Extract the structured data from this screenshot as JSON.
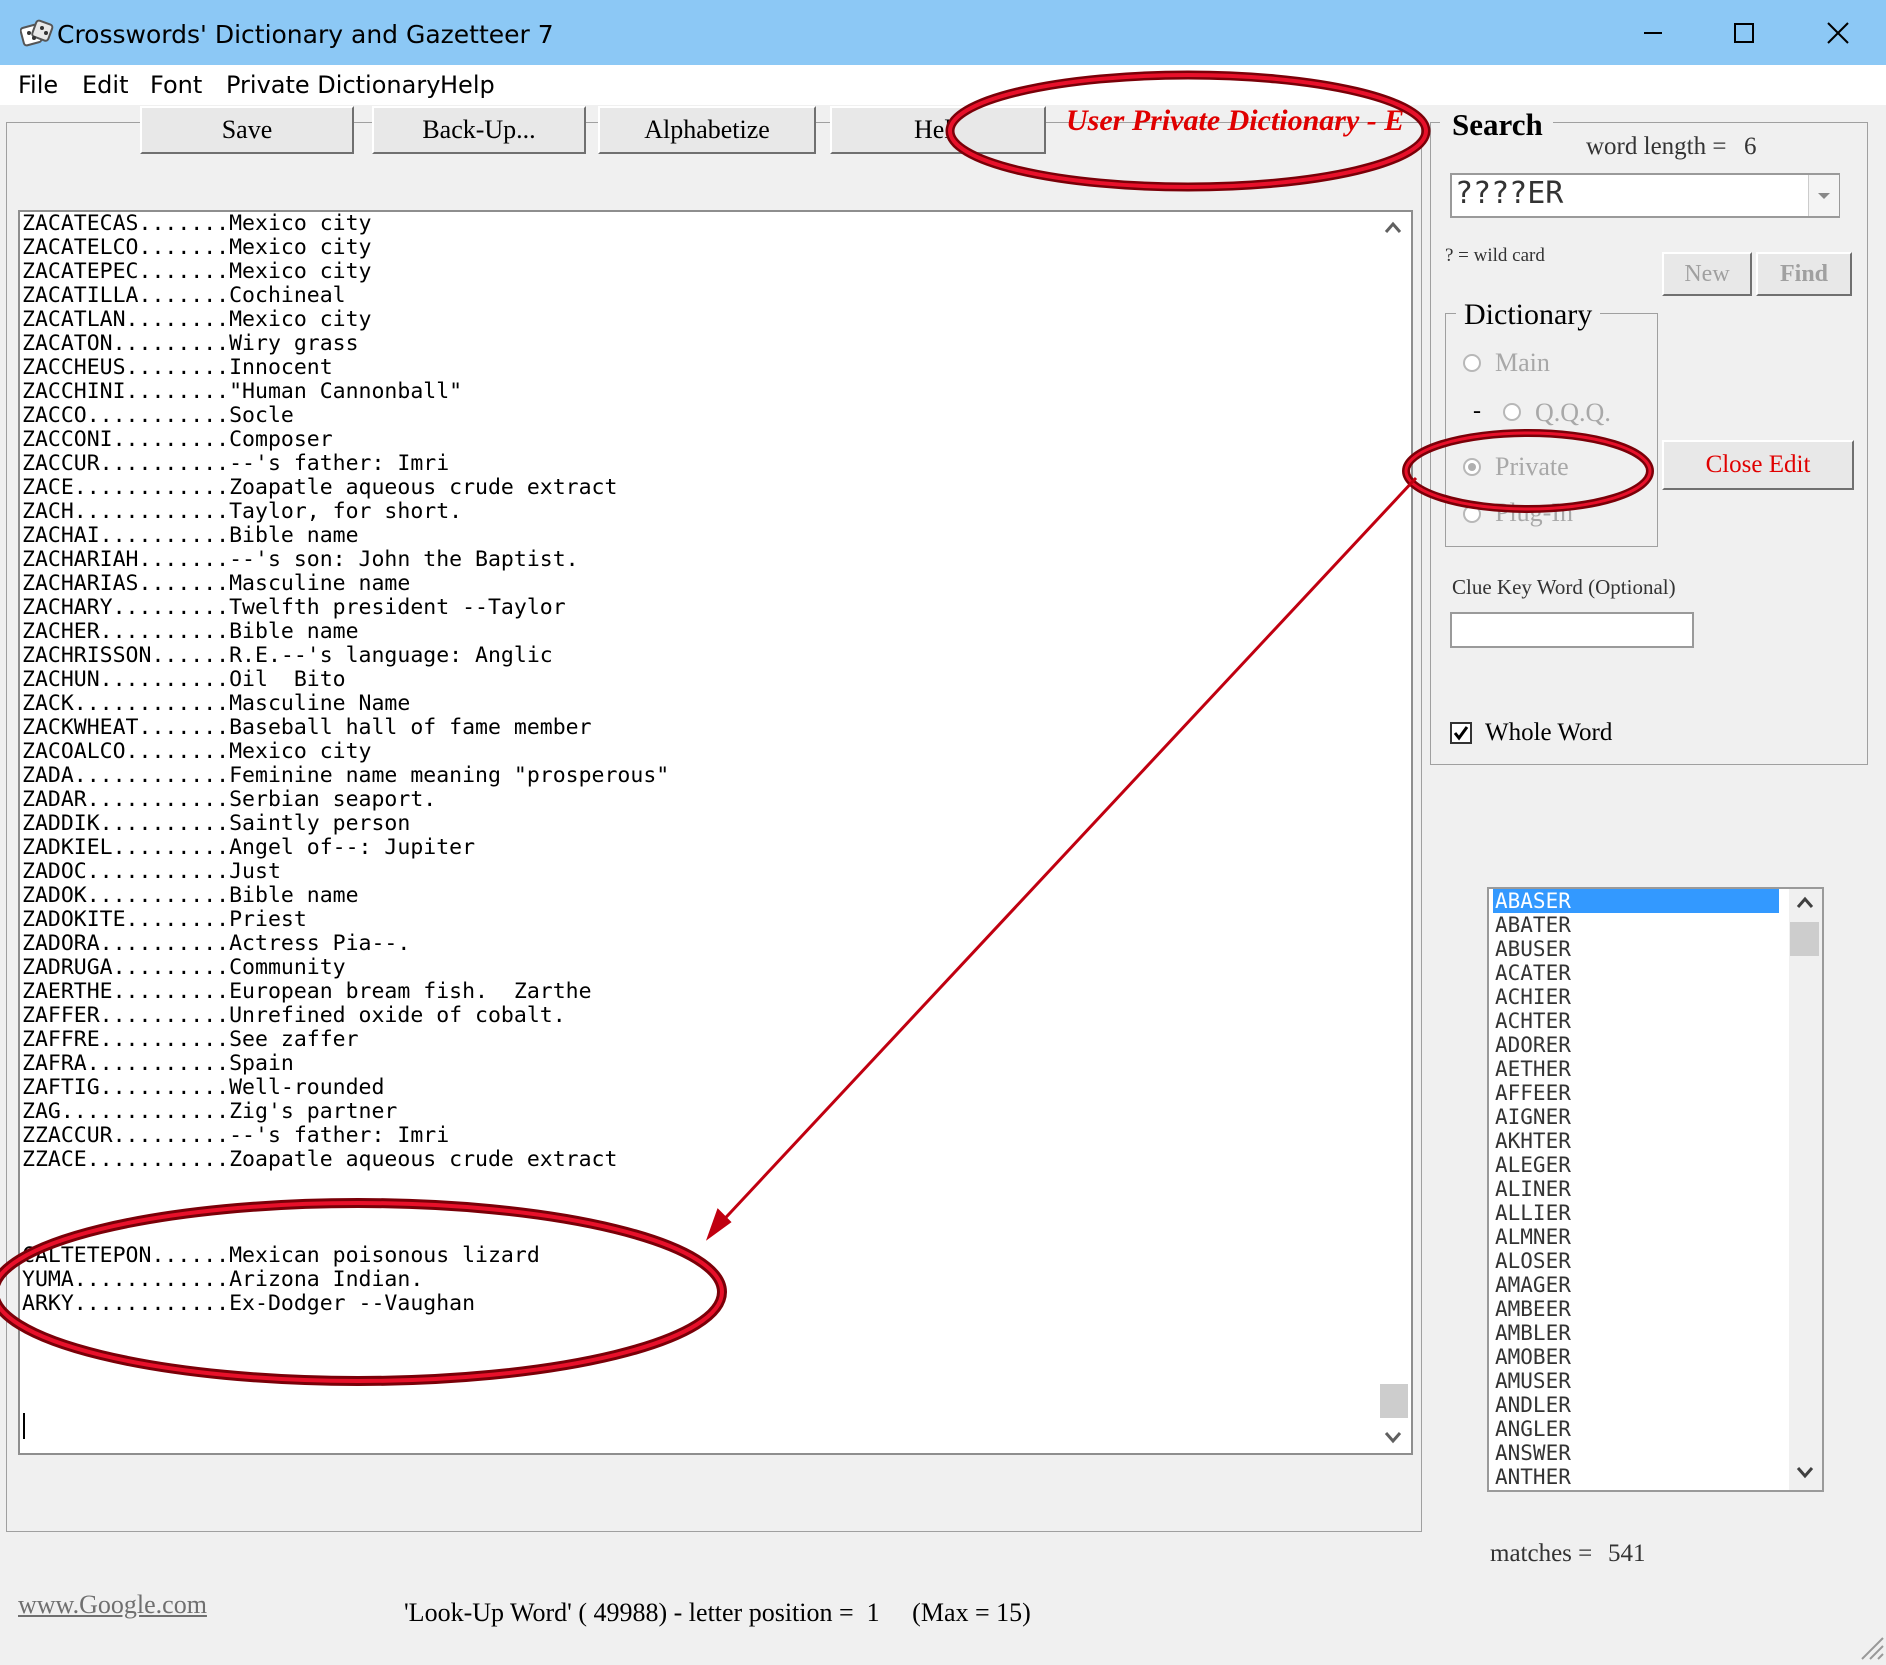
{
  "window": {
    "title": "Crosswords' Dictionary and Gazetteer 7",
    "app_icon": "dice-icon",
    "controls": [
      "minimize-icon",
      "maximize-icon",
      "close-icon"
    ]
  },
  "menu": [
    "File",
    "Edit",
    "Font",
    "Private Dictionary",
    "Help"
  ],
  "toolbar": {
    "save": "Save",
    "backup": "Back-Up...",
    "alphabetize": "Alphabetize",
    "help": "Hel",
    "banner": "User Private Dictionary - E"
  },
  "editor": {
    "lines": [
      "ZACATECAS.......Mexico city",
      "ZACATELCO.......Mexico city",
      "ZACATEPEC.......Mexico city",
      "ZACATILLA.......Cochineal",
      "ZACATLAN........Mexico city",
      "ZACATON.........Wiry grass",
      "ZACCHEUS........Innocent",
      "ZACCHINI........\"Human Cannonball\"",
      "ZACCO...........Socle",
      "ZACCONI.........Composer",
      "ZACCUR..........--'s father: Imri",
      "ZACE............Zoapatle aqueous crude extract",
      "ZACH............Taylor, for short.",
      "ZACHAI..........Bible name",
      "ZACHARIAH.......--'s son: John the Baptist.",
      "ZACHARIAS.......Masculine name",
      "ZACHARY.........Twelfth president --Taylor",
      "ZACHER..........Bible name",
      "ZACHRISSON......R.E.--'s language: Anglic",
      "ZACHUN..........Oil  Bito",
      "ZACK............Masculine Name",
      "ZACKWHEAT.......Baseball hall of fame member",
      "ZACOALCO........Mexico city",
      "ZADA............Feminine name meaning \"prosperous\"",
      "ZADAR...........Serbian seaport.",
      "ZADDIK..........Saintly person",
      "ZADKIEL.........Angel of--: Jupiter",
      "ZADOC...........Just",
      "ZADOK...........Bible name",
      "ZADOKITE........Priest",
      "ZADORA..........Actress Pia--.",
      "ZADRUGA.........Community",
      "ZAERTHE.........European bream fish.  Zarthe",
      "ZAFFER..........Unrefined oxide of cobalt.",
      "ZAFFRE..........See zaffer",
      "ZAFRA...........Spain",
      "ZAFTIG..........Well-rounded",
      "ZAG.............Zig's partner",
      "ZZACCUR.........--'s father: Imri",
      "ZZACE...........Zoapatle aqueous crude extract",
      "",
      "",
      "",
      "CALTETEPON......Mexican poisonous lizard",
      "YUMA............Arizona Indian.",
      "ARKY............Ex-Dodger --Vaughan"
    ]
  },
  "search": {
    "heading": "Search",
    "word_length_label": "word length =",
    "word_length_value": "6",
    "query": "????ER",
    "wildcard_hint": "? = wild card",
    "new_button": "New",
    "find_button": "Find",
    "dictionary_heading": "Dictionary",
    "radio_main": "Main",
    "radio_qqq_prefix": "-",
    "radio_qqq": "Q.Q.Q.",
    "radio_private": "Private",
    "radio_plugin": "Plug-In",
    "selected_dictionary": "Private",
    "close_edit": "Close Edit",
    "clue_key_label": "Clue Key Word (Optional)",
    "clue_key_value": "",
    "whole_word_label": "Whole Word",
    "whole_word_checked": true
  },
  "results": {
    "selected": "ABASER",
    "items": [
      "ABASER",
      "ABATER",
      "ABUSER",
      "ACATER",
      "ACHIER",
      "ACHTER",
      "ADORER",
      "AETHER",
      "AFFEER",
      "AIGNER",
      "AKHTER",
      "ALEGER",
      "ALINER",
      "ALLIER",
      "ALMNER",
      "ALOSER",
      "AMAGER",
      "AMBEER",
      "AMBLER",
      "AMOBER",
      "AMUSER",
      "ANDLER",
      "ANGLER",
      "ANSWER",
      "ANTHER"
    ],
    "matches_label": "matches =",
    "matches_value": "541"
  },
  "status": {
    "link": "www.Google.com",
    "lookup_text": "'Look-Up Word' ( 49988) - letter position =  1     (Max = 15)"
  },
  "colors": {
    "titlebar": "#8cc8f5",
    "banner_red": "#e00000",
    "annotation_red": "#c00010",
    "selection_blue": "#3399ff"
  }
}
